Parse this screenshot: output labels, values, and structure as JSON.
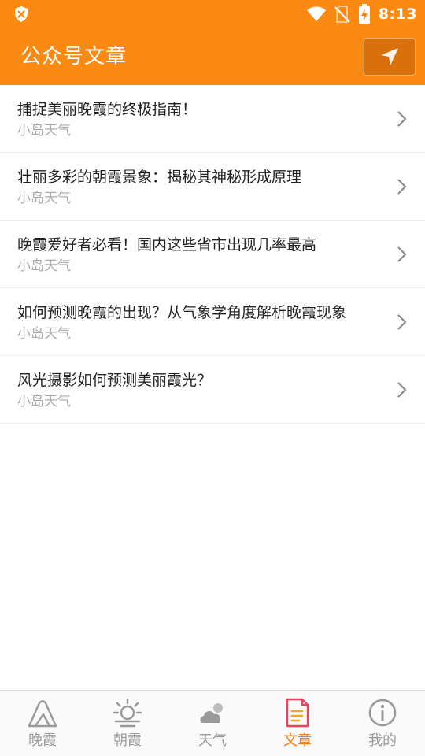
{
  "status_bar": {
    "time": "8:13",
    "icons": [
      "shield-x-icon",
      "wifi-icon",
      "no-sim-icon",
      "battery-charging-icon"
    ]
  },
  "app_bar": {
    "title": "公众号文章",
    "action_icon": "send-icon"
  },
  "articles": [
    {
      "title": "捕捉美丽晚霞的终极指南！",
      "source": "小岛天气"
    },
    {
      "title": "壮丽多彩的朝霞景象：揭秘其神秘形成原理",
      "source": "小岛天气"
    },
    {
      "title": "晚霞爱好者必看！国内这些省市出现几率最高",
      "source": "小岛天气"
    },
    {
      "title": "如何预测晚霞的出现？从气象学角度解析晚霞现象",
      "source": "小岛天气"
    },
    {
      "title": "风光摄影如何预测美丽霞光？",
      "source": "小岛天气"
    }
  ],
  "bottom_nav": [
    {
      "label": "晚霞",
      "icon": "mountain-icon",
      "active": false
    },
    {
      "label": "朝霞",
      "icon": "sunrise-icon",
      "active": false
    },
    {
      "label": "天气",
      "icon": "cloud-icon",
      "active": false
    },
    {
      "label": "文章",
      "icon": "article-icon",
      "active": true
    },
    {
      "label": "我的",
      "icon": "info-icon",
      "active": false
    }
  ],
  "colors": {
    "primary": "#fb8a12",
    "active_tab": "#f57c12",
    "inactive_tab": "#9a9a9a"
  }
}
